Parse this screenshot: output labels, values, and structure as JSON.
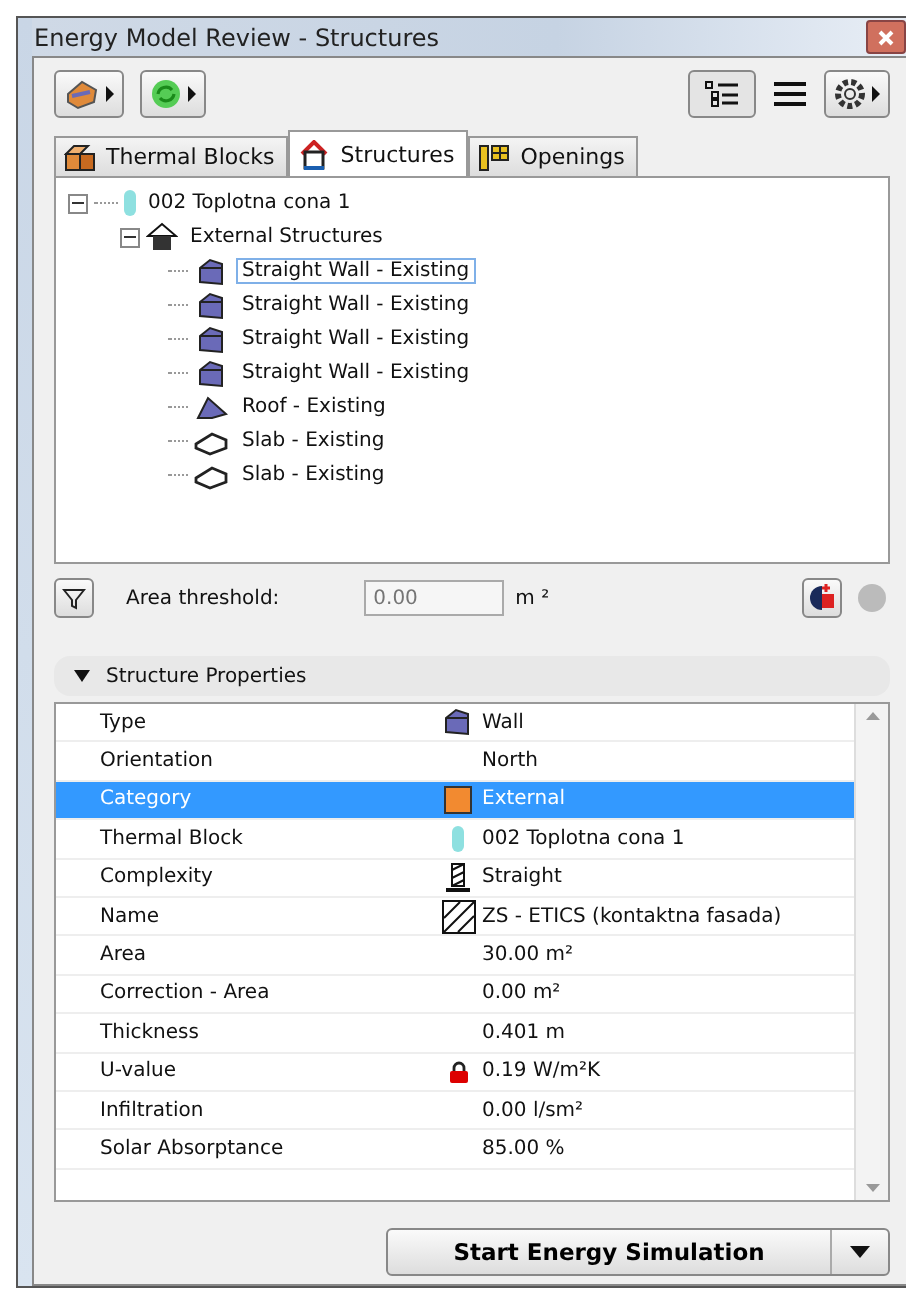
{
  "window": {
    "title": "Energy Model Review - Structures"
  },
  "tabs": [
    {
      "label": "Thermal Blocks",
      "kind": "blocks",
      "selected": false
    },
    {
      "label": "Structures",
      "kind": "house",
      "selected": true
    },
    {
      "label": "Openings",
      "kind": "openings",
      "selected": false
    }
  ],
  "tree": {
    "label": "002 Toplotna cona 1",
    "expanded": true,
    "children": [
      {
        "label": "External Structures",
        "expanded": true,
        "children": [
          {
            "label": "Straight Wall - Existing",
            "kind": "wall",
            "selected": true
          },
          {
            "label": "Straight Wall - Existing",
            "kind": "wall",
            "selected": false
          },
          {
            "label": "Straight Wall - Existing",
            "kind": "wall",
            "selected": false
          },
          {
            "label": "Straight Wall - Existing",
            "kind": "wall",
            "selected": false
          },
          {
            "label": "Roof - Existing",
            "kind": "roof",
            "selected": false
          },
          {
            "label": "Slab - Existing",
            "kind": "slab",
            "selected": false
          },
          {
            "label": "Slab - Existing",
            "kind": "slab",
            "selected": false
          }
        ]
      }
    ]
  },
  "filter": {
    "label": "Area threshold:",
    "placeholder": "0.00",
    "unit": "m ²"
  },
  "section": {
    "title": "Structure Properties",
    "expanded": true
  },
  "properties": [
    {
      "label": "Type",
      "value": "Wall",
      "kind": "wall",
      "selected": false
    },
    {
      "label": "Orientation",
      "value": "North",
      "selected": false
    },
    {
      "label": "Category",
      "value": "External",
      "kind": "swatch",
      "color": "#f28a30",
      "selected": true
    },
    {
      "label": "Thermal Block",
      "value": "002 Toplotna cona 1",
      "kind": "block",
      "selected": false
    },
    {
      "label": "Complexity",
      "value": "Straight",
      "kind": "straight",
      "selected": false
    },
    {
      "label": "Name",
      "value": "ZS - ETICS (kontaktna fasada)",
      "kind": "pattern",
      "selected": false
    },
    {
      "label": "Area",
      "value": "30.00 m²",
      "selected": false
    },
    {
      "label": "Correction - Area",
      "value": "0.00 m²",
      "selected": false
    },
    {
      "label": "Thickness",
      "value": "0.401 m",
      "selected": false
    },
    {
      "label": "U-value",
      "value": "0.19 W/m²K",
      "kind": "lock",
      "selected": false
    },
    {
      "label": "Infiltration",
      "value": "0.00 l/sm²",
      "selected": false
    },
    {
      "label": "Solar Absorptance",
      "value": "85.00 %",
      "selected": false
    }
  ],
  "action": {
    "label": "Start Energy Simulation"
  }
}
